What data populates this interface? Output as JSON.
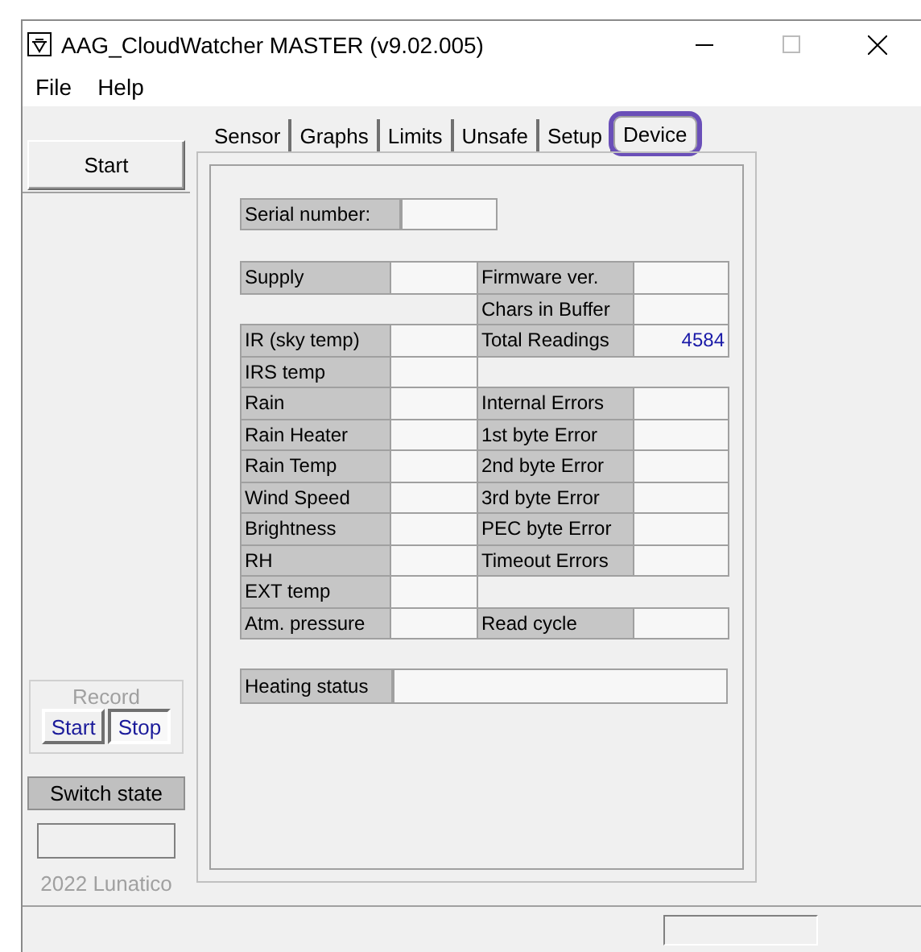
{
  "window": {
    "title": "AAG_CloudWatcher MASTER (v9.02.005)"
  },
  "menu": [
    "File",
    "Help"
  ],
  "start_button": "Start",
  "tabs": [
    {
      "label": "Sensor",
      "selected": false,
      "highlighted": false
    },
    {
      "label": "Graphs",
      "selected": false,
      "highlighted": false
    },
    {
      "label": "Limits",
      "selected": false,
      "highlighted": false
    },
    {
      "label": "Unsafe",
      "selected": false,
      "highlighted": false
    },
    {
      "label": "Setup",
      "selected": false,
      "highlighted": false
    },
    {
      "label": "Device",
      "selected": true,
      "highlighted": true
    }
  ],
  "serial": {
    "label": "Serial number:"
  },
  "rows": [
    {
      "left": {
        "label": "Supply"
      },
      "right": {
        "label": "Firmware ver."
      }
    },
    {
      "right": {
        "label": "Chars in Buffer"
      }
    },
    {
      "left": {
        "label": "IR (sky temp)"
      },
      "right": {
        "label": "Total Readings",
        "value": "4584"
      }
    },
    {
      "left": {
        "label": "IRS temp"
      }
    },
    {
      "left": {
        "label": "Rain"
      },
      "right": {
        "label": "Internal Errors"
      }
    },
    {
      "left": {
        "label": "Rain Heater"
      },
      "right": {
        "label": "1st byte Error"
      }
    },
    {
      "left": {
        "label": "Rain Temp"
      },
      "right": {
        "label": "2nd byte Error"
      }
    },
    {
      "left": {
        "label": "Wind Speed"
      },
      "right": {
        "label": "3rd byte Error"
      }
    },
    {
      "left": {
        "label": "Brightness"
      },
      "right": {
        "label": "PEC byte Error"
      }
    },
    {
      "left": {
        "label": "RH"
      },
      "right": {
        "label": "Timeout Errors"
      }
    },
    {
      "left": {
        "label": "EXT temp"
      }
    },
    {
      "left": {
        "label": "Atm. pressure"
      },
      "right": {
        "label": "Read cycle"
      }
    }
  ],
  "heating": {
    "label": "Heating status"
  },
  "record": {
    "title": "Record",
    "buttons": [
      {
        "label": "Start",
        "selected": false
      },
      {
        "label": "Stop",
        "selected": true
      }
    ]
  },
  "switch_state": "Switch state",
  "copyright": "2022 Lunatico"
}
